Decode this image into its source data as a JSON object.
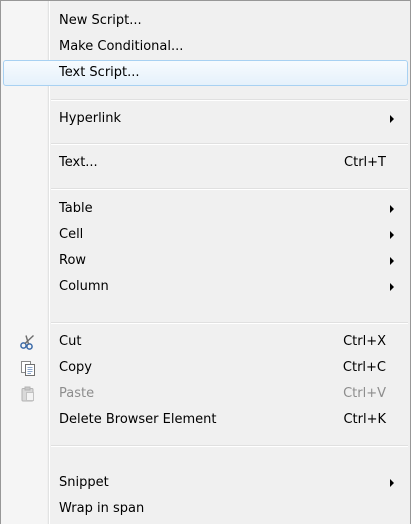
{
  "menu": {
    "new_script": "New Script...",
    "make_conditional": "Make Conditional...",
    "text_script": "Text Script...",
    "hyperlink": "Hyperlink",
    "text": "Text...",
    "text_shortcut": "Ctrl+T",
    "table": "Table",
    "cell": "Cell",
    "row": "Row",
    "column": "Column",
    "cut": "Cut",
    "cut_shortcut": "Ctrl+X",
    "copy": "Copy",
    "copy_shortcut": "Ctrl+C",
    "paste": "Paste",
    "paste_shortcut": "Ctrl+V",
    "delete_browser_element": "Delete Browser Element",
    "delete_shortcut": "Ctrl+K",
    "snippet": "Snippet",
    "wrap_in_span": "Wrap in span"
  },
  "colors": {
    "menu_background": "#f0f0f0",
    "highlight_border": "#a8d1f2",
    "disabled_text": "#8d8d8d"
  },
  "icons": {
    "cut": "scissors-icon",
    "copy": "copy-icon",
    "paste": "paste-icon"
  }
}
